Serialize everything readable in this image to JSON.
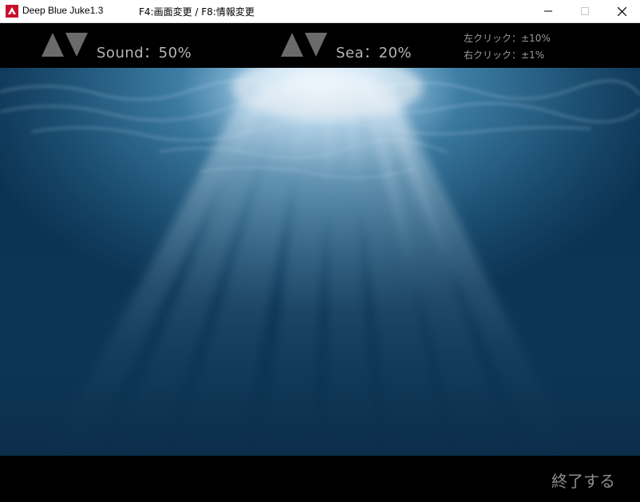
{
  "window": {
    "title": "Deep Blue Juke1.3",
    "hint": "F4:画面変更 / F8:情報変更",
    "icons": {
      "app": "juke-app-icon",
      "minimize": "minimize-icon",
      "maximize": "maximize-icon",
      "close": "close-icon"
    }
  },
  "controls": {
    "sound": {
      "label": "Sound：50%",
      "value_percent": 50
    },
    "sea": {
      "label": "Sea：20%",
      "value_percent": 20
    },
    "hints": {
      "left_click": "左クリック：±10%",
      "right_click": "右クリック：±1%"
    }
  },
  "scene": {
    "description_icon": "underwater-light-rays-image"
  },
  "footer": {
    "exit_label": "終了する"
  },
  "colors": {
    "bar_bg": "#000000",
    "label": "#b5b5b5",
    "arrow": "#6b6b6b",
    "water_light": "#e8f4ff",
    "water_mid": "#2d6a8c",
    "water_deep": "#0b2f4b"
  }
}
